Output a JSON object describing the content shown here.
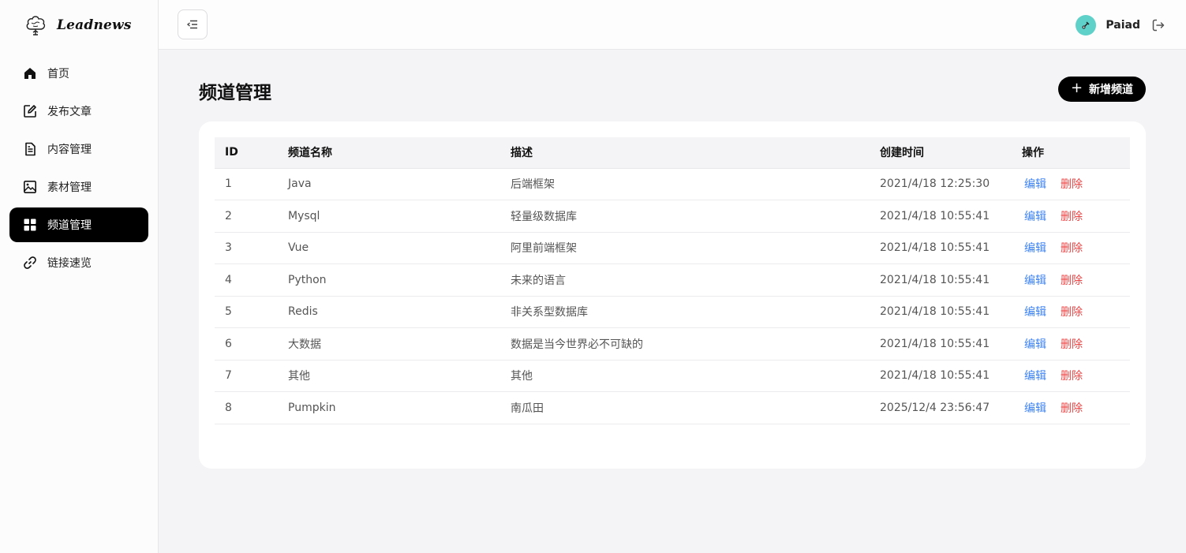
{
  "brand": {
    "name": "Leadnews",
    "icon": "brain-tree-logo-icon"
  },
  "sidebar": {
    "items": [
      {
        "label": "首页",
        "icon": "home-icon"
      },
      {
        "label": "发布文章",
        "icon": "edit-icon"
      },
      {
        "label": "内容管理",
        "icon": "document-icon"
      },
      {
        "label": "素材管理",
        "icon": "image-icon"
      },
      {
        "label": "频道管理",
        "icon": "grid-icon",
        "active": true
      },
      {
        "label": "链接速览",
        "icon": "link-icon"
      }
    ]
  },
  "header": {
    "user": {
      "name": "Paiad",
      "avatar_color": "#5fd1c9"
    },
    "toggle_icon": "menu-fold-icon",
    "logout_icon": "logout-icon"
  },
  "main": {
    "title": "频道管理",
    "add_button": {
      "label": "新增频道",
      "icon": "plus-icon"
    },
    "table": {
      "columns": [
        "ID",
        "频道名称",
        "描述",
        "创建时间",
        "操作"
      ],
      "rows": [
        {
          "id": "1",
          "name": "Java",
          "desc": "后端框架",
          "time": "2021/4/18 12:25:30"
        },
        {
          "id": "2",
          "name": "Mysql",
          "desc": "轻量级数据库",
          "time": "2021/4/18 10:55:41"
        },
        {
          "id": "3",
          "name": "Vue",
          "desc": "阿里前端框架",
          "time": "2021/4/18 10:55:41"
        },
        {
          "id": "4",
          "name": "Python",
          "desc": "未来的语言",
          "time": "2021/4/18 10:55:41"
        },
        {
          "id": "5",
          "name": "Redis",
          "desc": "非关系型数据库",
          "time": "2021/4/18 10:55:41"
        },
        {
          "id": "6",
          "name": "大数据",
          "desc": "数据是当今世界必不可缺的",
          "time": "2021/4/18 10:55:41"
        },
        {
          "id": "7",
          "name": "其他",
          "desc": "其他",
          "time": "2021/4/18 10:55:41"
        },
        {
          "id": "8",
          "name": "Pumpkin",
          "desc": "南瓜田",
          "time": "2025/12/4 23:56:47"
        }
      ],
      "edit_label": "编辑",
      "delete_label": "删除"
    }
  },
  "colors": {
    "accent": "#000000",
    "link": "#3b82f6",
    "danger": "#ef4444"
  }
}
